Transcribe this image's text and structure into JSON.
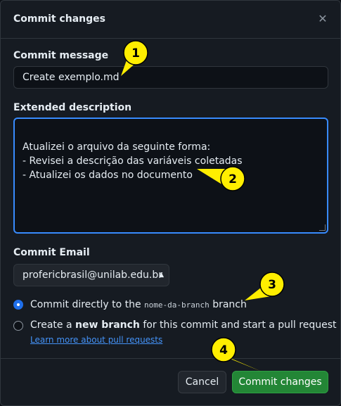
{
  "dialog": {
    "title": "Commit changes",
    "close_icon": "close-icon"
  },
  "commit_message": {
    "label": "Commit message",
    "value": "Create exemplo.md"
  },
  "extended_description": {
    "label": "Extended description",
    "value": "Atualizei o arquivo da seguinte forma:\n- Revisei a descrição das variáveis coletadas\n- Atualizei os dados no documento"
  },
  "commit_email": {
    "label": "Commit Email",
    "value": "profericbrasil@unilab.edu.br"
  },
  "options": {
    "direct_prefix": "Commit directly to the",
    "branch_name": "nome-da-branch",
    "direct_suffix": "branch",
    "new_prefix": "Create a",
    "new_bold": "new branch",
    "new_suffix": "for this commit and start a pull request",
    "learn_more": "Learn more about pull requests",
    "selected": "direct"
  },
  "footer": {
    "cancel_label": "Cancel",
    "commit_label": "Commit changes"
  },
  "annotations": {
    "markers": [
      "1",
      "2",
      "3",
      "4"
    ],
    "marker_color": "#ffee00"
  },
  "colors": {
    "accent": "#1f6feb",
    "commit_button": "#238636",
    "link": "#4493f8",
    "focus_border": "#388bfd"
  }
}
